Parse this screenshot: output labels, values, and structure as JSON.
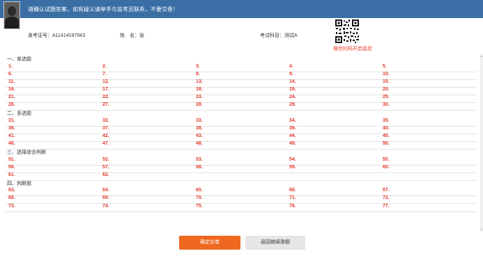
{
  "banner": {
    "message": "请确认试题答案，如有疑义请举手与监考员联系，不要交卷！"
  },
  "candidate": {
    "id_label": "准考证号：",
    "id_value": "A11414197943",
    "name_label": "姓　名：",
    "name_value": "张",
    "subject_label": "考试科目：",
    "subject_value": "测试A"
  },
  "qr": {
    "caption": "微信扫码开启监控"
  },
  "sections": [
    {
      "title": "一、单选题",
      "rows": [
        [
          "1.",
          "2.",
          "3.",
          "4.",
          "5."
        ],
        [
          "6.",
          "7.",
          "8.",
          "9.",
          "10."
        ],
        [
          "11.",
          "12.",
          "13.",
          "14.",
          "15."
        ],
        [
          "16.",
          "17.",
          "18.",
          "19.",
          "20."
        ],
        [
          "21.",
          "22.",
          "23.",
          "24.",
          "25."
        ],
        [
          "26.",
          "27.",
          "28.",
          "29.",
          "30."
        ]
      ]
    },
    {
      "title": "二、多选题",
      "rows": [
        [
          "31.",
          "32.",
          "33.",
          "34.",
          "35."
        ],
        [
          "36.",
          "37.",
          "38.",
          "39.",
          "40."
        ],
        [
          "41.",
          "42.",
          "43.",
          "44.",
          "45."
        ],
        [
          "46.",
          "47.",
          "48.",
          "49.",
          "50."
        ]
      ]
    },
    {
      "title": "三、选择综合判断",
      "rows": [
        [
          "51.",
          "52.",
          "53.",
          "54.",
          "55."
        ],
        [
          "56.",
          "57.",
          "58.",
          "59.",
          "60."
        ],
        [
          "61.",
          "62."
        ]
      ]
    },
    {
      "title": "四、判断题",
      "rows": [
        [
          "63.",
          "64.",
          "65.",
          "66.",
          "67."
        ],
        [
          "68.",
          "69.",
          "70.",
          "71.",
          "72."
        ],
        [
          "73.",
          "74.",
          "75.",
          "76.",
          "77."
        ]
      ]
    }
  ],
  "buttons": {
    "submit": "确定交卷",
    "back": "返回继续答题"
  },
  "colors": {
    "banner": "#3a6ea5",
    "answer_number": "#e43a2c",
    "submit_button": "#f06820",
    "back_button": "#e6e6e6"
  }
}
